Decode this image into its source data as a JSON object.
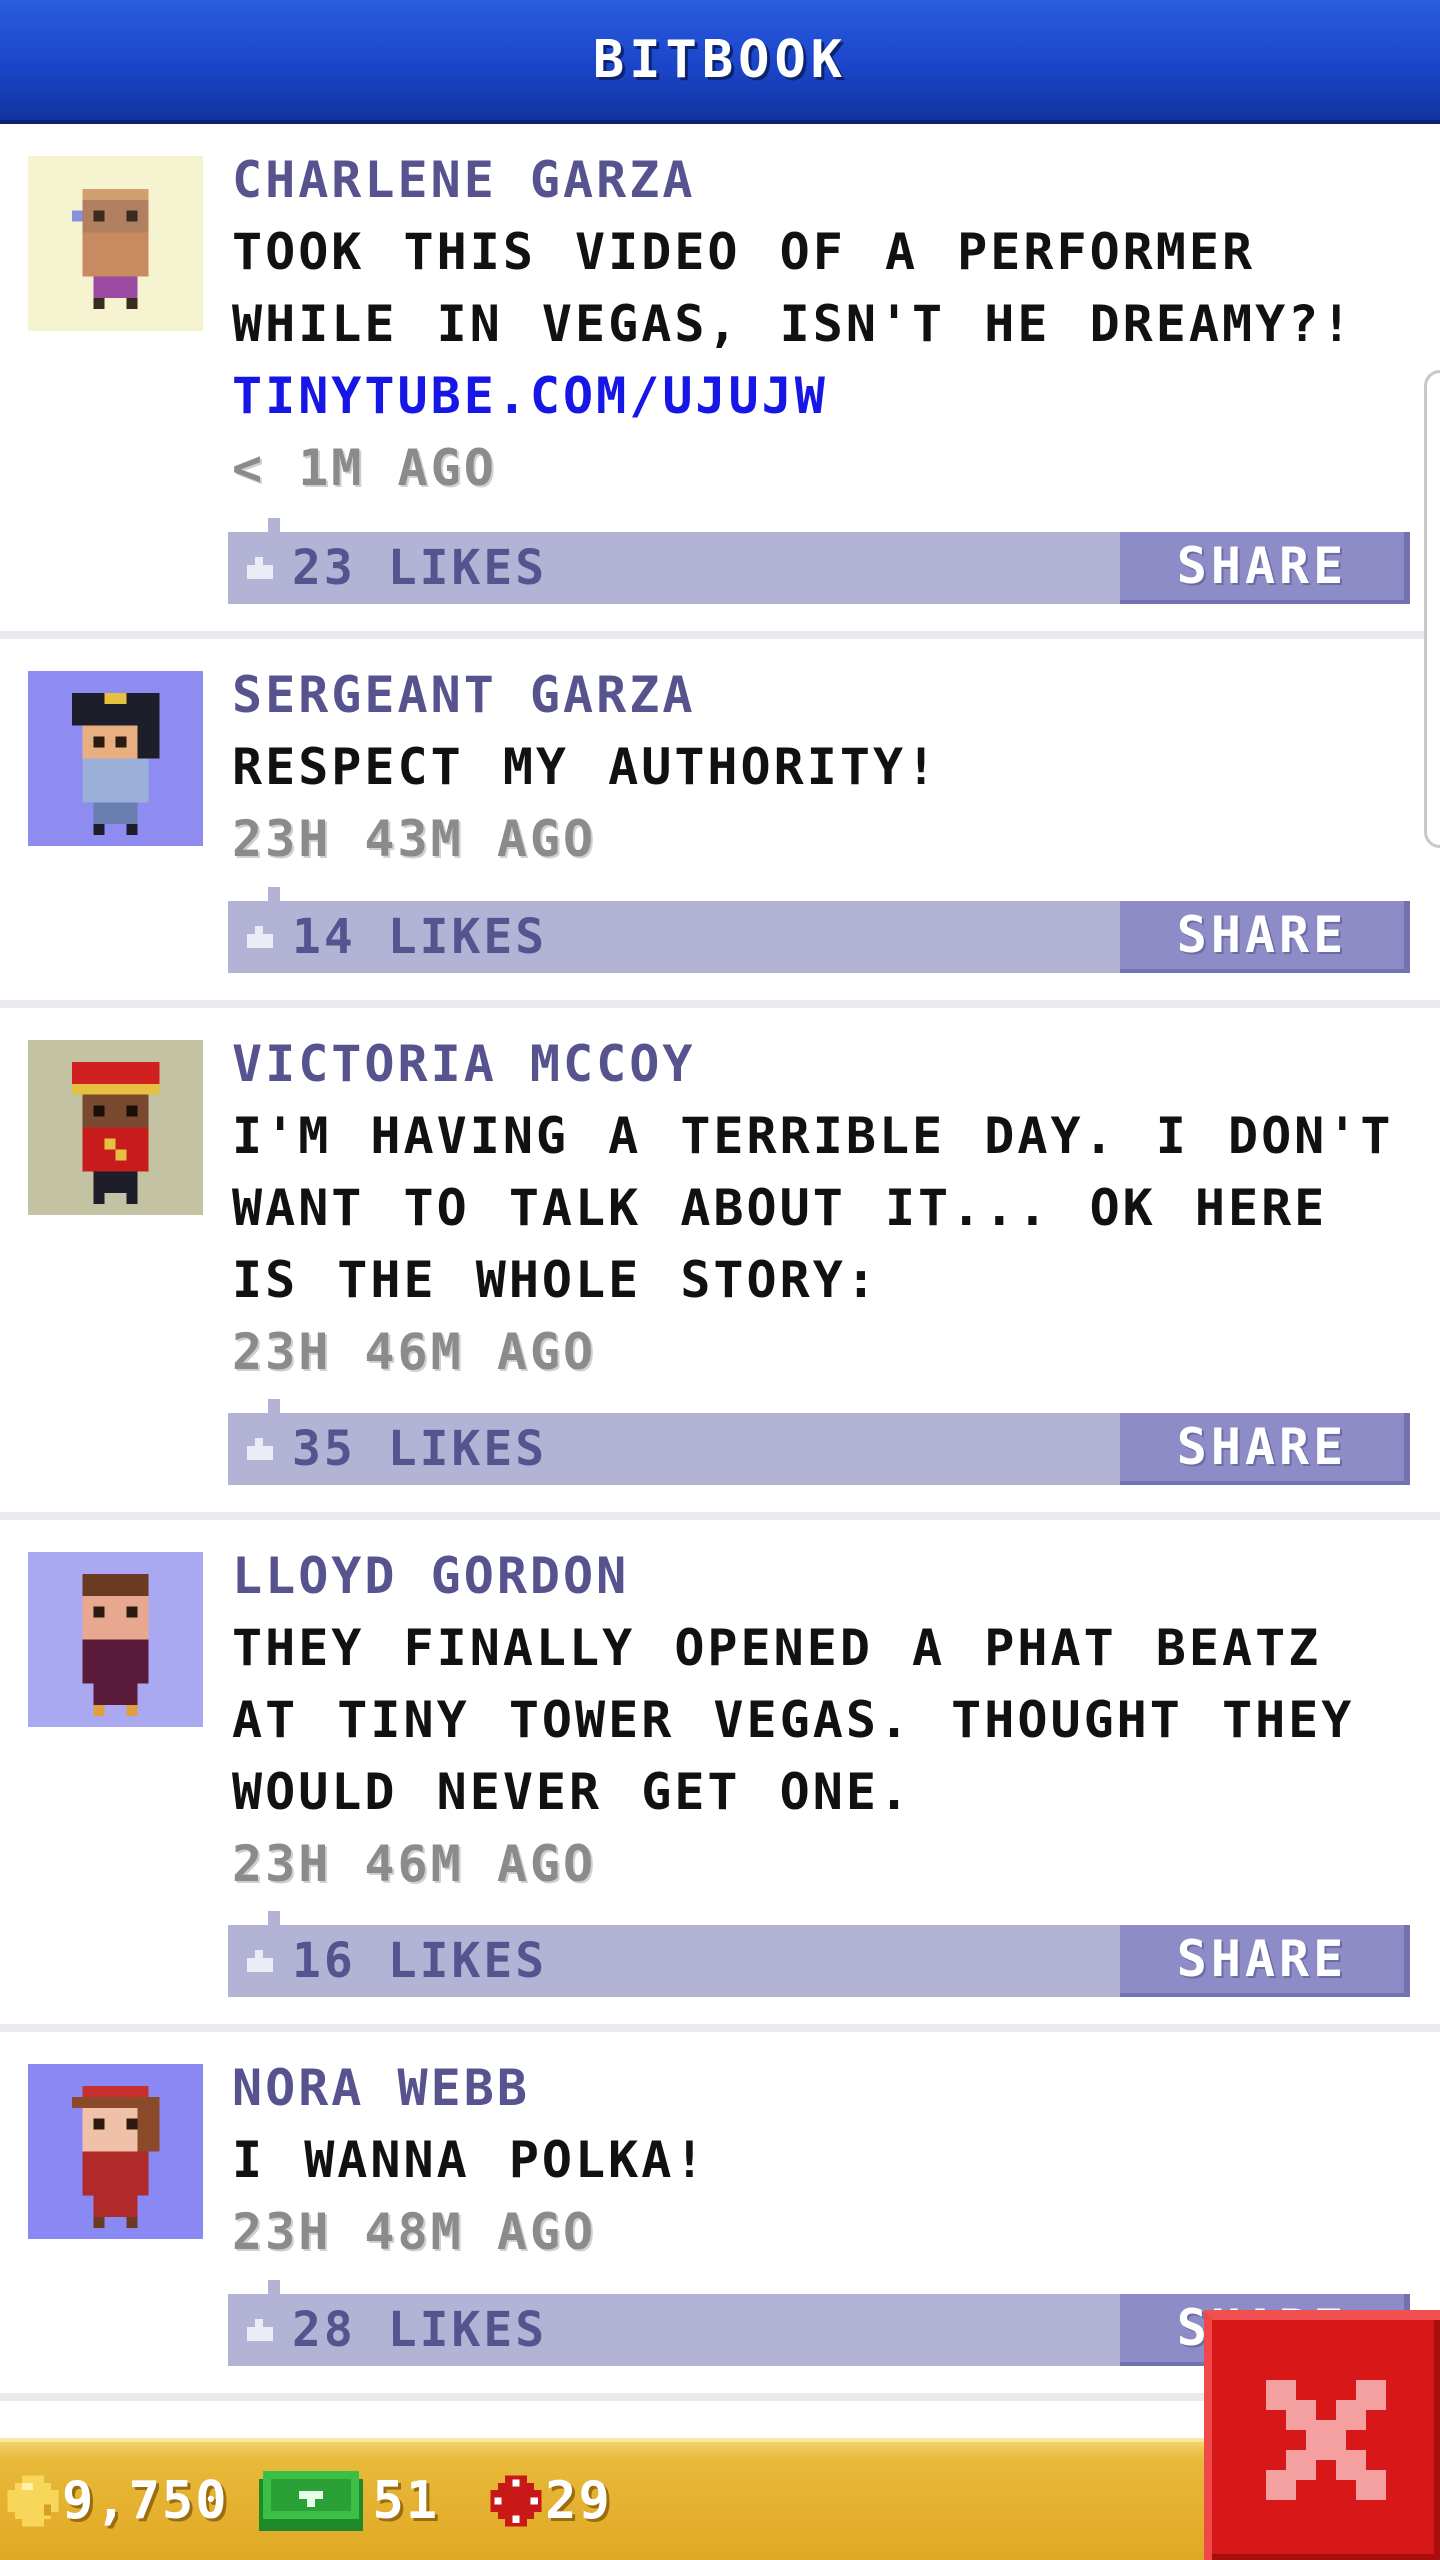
{
  "header": {
    "title": "BITBOOK"
  },
  "posts": [
    {
      "author": "CHARLENE GARZA",
      "message": "TOOK THIS VIDEO OF A PERFORMER WHILE IN VEGAS, ISN'T HE DREAMY?!",
      "link": "TINYTUBE.COM/UJUJW",
      "time": "< 1M AGO",
      "likes": "23 LIKES",
      "share": "SHARE",
      "avatar_bg": "#f6f3d0"
    },
    {
      "author": "SERGEANT GARZA",
      "message": "RESPECT MY AUTHORITY!",
      "time": "23H 43M AGO",
      "likes": "14 LIKES",
      "share": "SHARE",
      "avatar_bg": "#8e8cf0"
    },
    {
      "author": "VICTORIA MCCOY",
      "message": "I'M HAVING A TERRIBLE DAY. I DON'T WANT TO TALK ABOUT IT...  OK HERE IS THE WHOLE STORY:",
      "time": "23H 46M AGO",
      "likes": "35 LIKES",
      "share": "SHARE",
      "avatar_bg": "#c3c3a3"
    },
    {
      "author": "LLOYD GORDON",
      "message": "THEY FINALLY OPENED A PHAT BEATZ AT TINY TOWER VEGAS. THOUGHT THEY WOULD NEVER GET ONE.",
      "time": "23H 46M AGO",
      "likes": "16 LIKES",
      "share": "SHARE",
      "avatar_bg": "#aaa8f0"
    },
    {
      "author": "NORA WEBB",
      "message": "I WANNA POLKA!",
      "time": "23H 48M AGO",
      "likes": "28 LIKES",
      "share": "SHARE",
      "avatar_bg": "#8a88f2"
    }
  ],
  "status": {
    "coins": "9,750",
    "bux": "51",
    "tokens": "29"
  },
  "colors": {
    "accent_blue": "#1b45c9",
    "bar_lavender": "#b3b3d6",
    "author_purple": "#56538f",
    "link_blue": "#1616e6",
    "gold_bar": "#e0a824",
    "close_red": "#d81818"
  },
  "icons": [
    "thumb-up-icon",
    "coin-icon",
    "bux-icon",
    "token-icon",
    "close-icon"
  ]
}
